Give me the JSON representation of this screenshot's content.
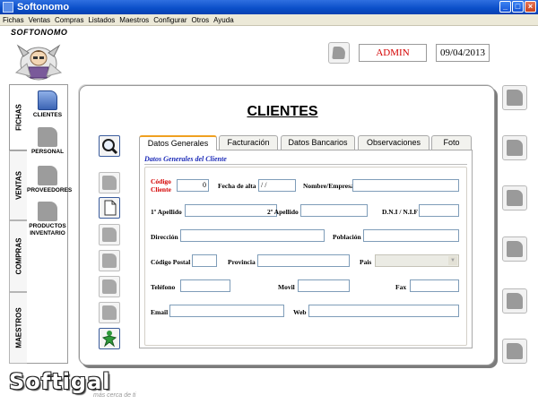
{
  "window": {
    "title": "Softonomo"
  },
  "menu": [
    "Fichas",
    "Ventas",
    "Compras",
    "Listados",
    "Maestros",
    "Configurar",
    "Otros",
    "Ayuda"
  ],
  "logo": {
    "text": "SOFTONOMO"
  },
  "header": {
    "user": "ADMIN",
    "date": "09/04/2013"
  },
  "side_tabs": [
    "FICHAS",
    "VENTAS",
    "COMPRAS",
    "MAESTROS"
  ],
  "nav_items": [
    "CLIENTES",
    "PERSONAL",
    "PROVEEDORES",
    "PRODUCTOS INVENTARIO"
  ],
  "page": {
    "title": "CLIENTES"
  },
  "tabs": [
    "Datos Generales",
    "Facturación",
    "Datos Bancarios",
    "Observaciones",
    "Foto"
  ],
  "form": {
    "section_title": "Datos Generales del Cliente",
    "codigo_label": "Código Cliente",
    "codigo_value": "0",
    "fecha_alta_label": "Fecha de alta",
    "fecha_alta_value": "/ /",
    "nombre_label": "Nombre/Empresa",
    "apellido1_label": "1º Apellido",
    "apellido2_label": "2º Apellido",
    "dni_label": "D.N.I / N.I.F",
    "direccion_label": "Dirección",
    "poblacion_label": "Población",
    "cp_label": "Código Postal",
    "provincia_label": "Provincia",
    "pais_label": "Pais",
    "telefono_label": "Teléfono",
    "movil_label": "Movil",
    "fax_label": "Fax",
    "email_label": "Email",
    "web_label": "Web"
  },
  "brand": {
    "name": "Softigal",
    "tagline": "más cerca de ti"
  },
  "colors": {
    "titlebar": "#0a4ec8",
    "accent_red": "#d40000",
    "section_blue": "#1c2bb8",
    "tab_active_top": "#f0a020"
  }
}
